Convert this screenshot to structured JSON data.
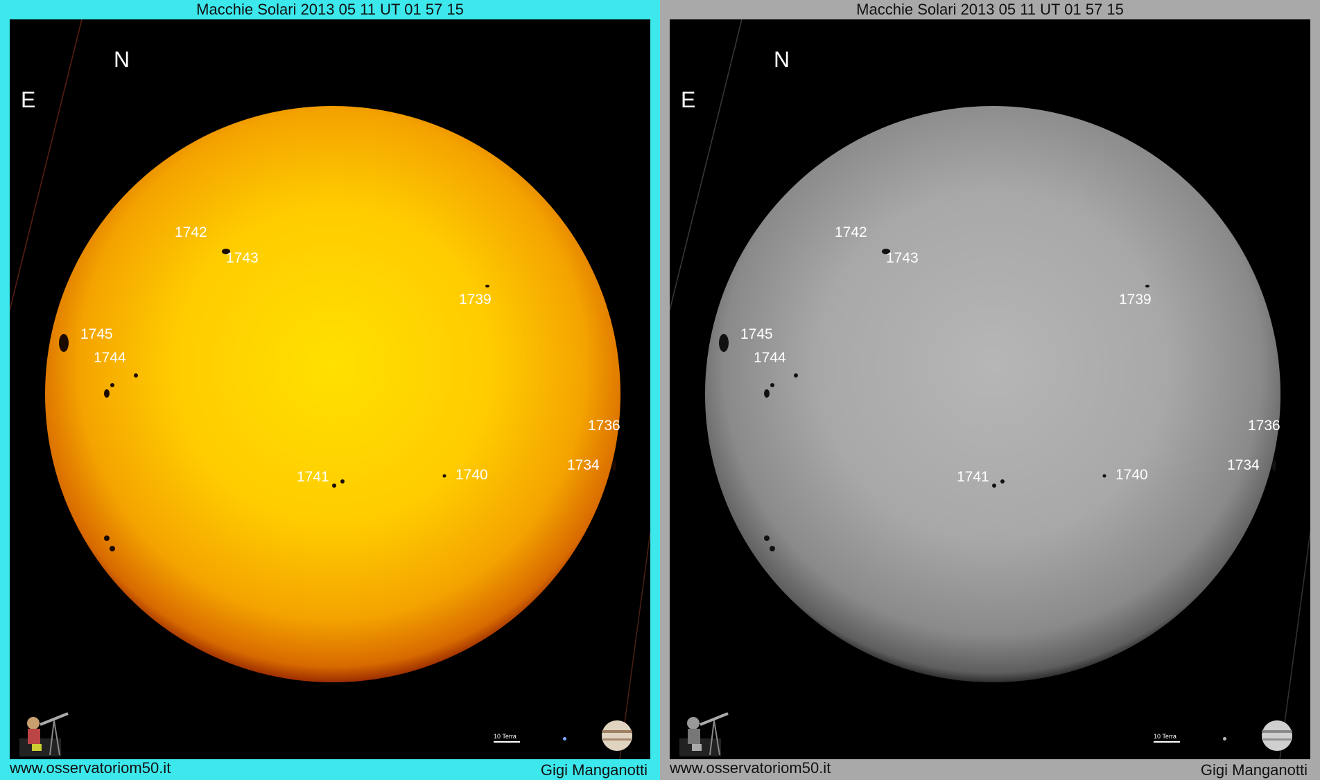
{
  "title": "Macchie Solari 2013 05 11 UT 01 57 15",
  "directions": {
    "north": "N",
    "east": "E"
  },
  "sunspot_labels": [
    "1742",
    "1743",
    "1739",
    "1745",
    "1744",
    "1736",
    "1734",
    "1741",
    "1740"
  ],
  "scale_label": "10 Terra",
  "footer": {
    "website": "www.osservatoriom50.it",
    "author": "Gigi Manganotti"
  },
  "panels": [
    {
      "variant": "color",
      "border_color": "#3de8ec"
    },
    {
      "variant": "grayscale",
      "border_color": "#a9a9a9"
    }
  ],
  "icons": {
    "observer_logo": "observer-telescope-logo-icon",
    "jupiter": "jupiter-icon",
    "earth": "earth-dot-icon"
  }
}
